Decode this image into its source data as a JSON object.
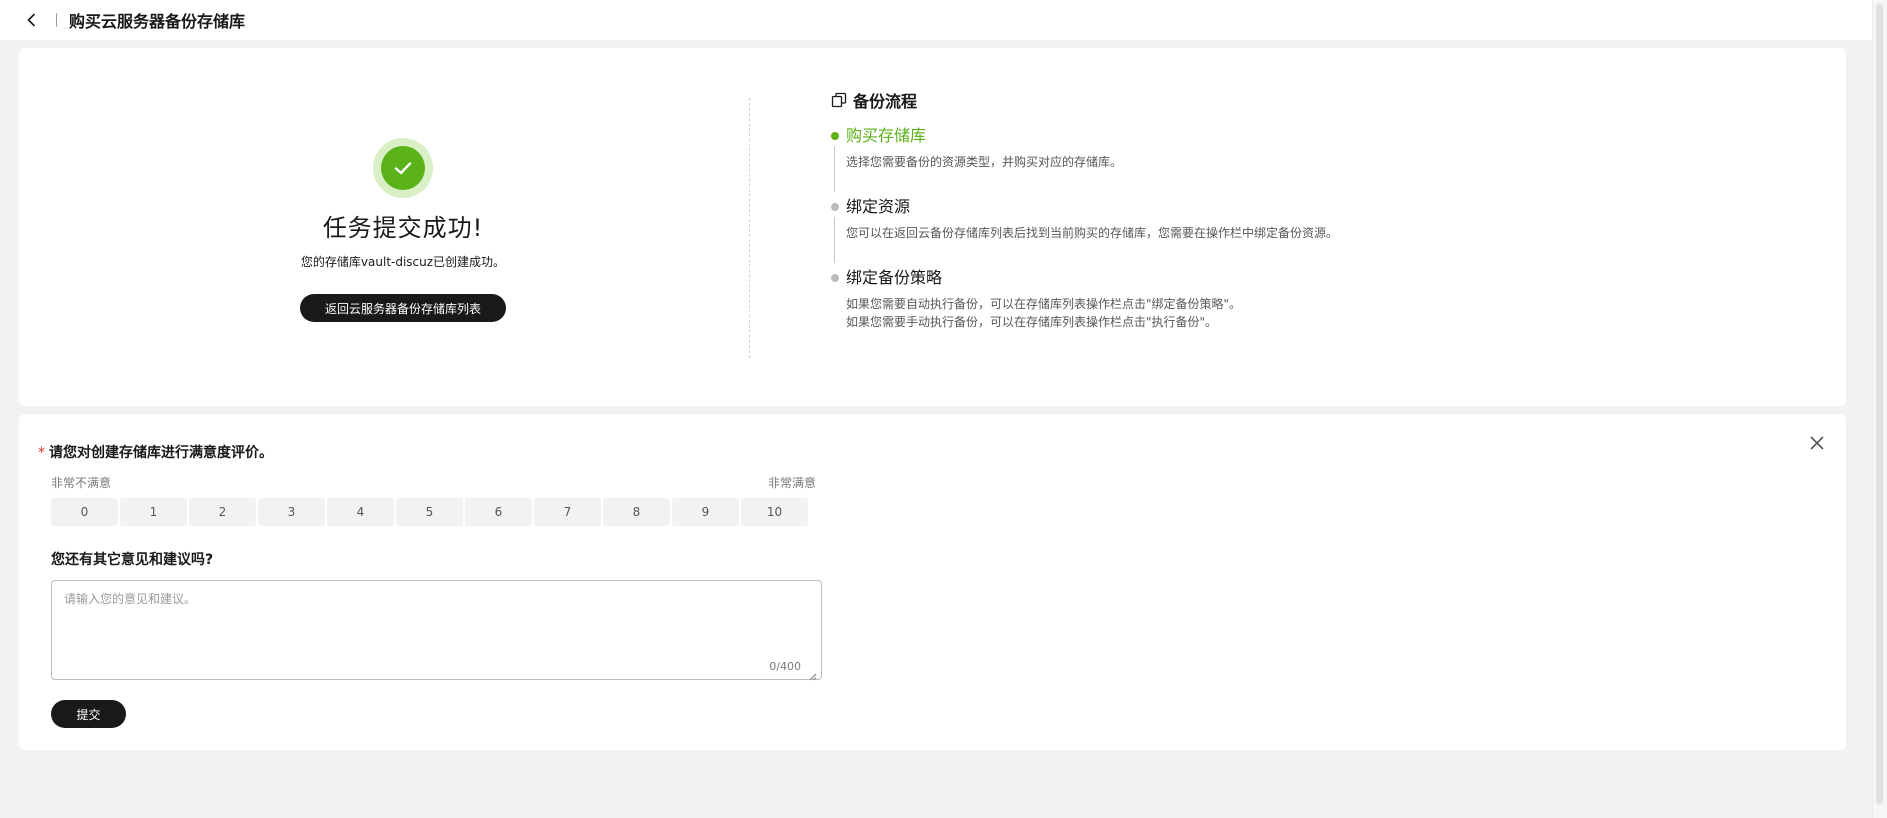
{
  "header": {
    "title": "购买云服务器备份存储库"
  },
  "success": {
    "title": "任务提交成功!",
    "description": "您的存储库vault-discuz已创建成功。",
    "return_button": "返回云服务器备份存储库列表"
  },
  "process": {
    "title": "备份流程",
    "steps": [
      {
        "title": "购买存储库",
        "desc1": "选择您需要备份的资源类型，并购买对应的存储库。",
        "desc2": ""
      },
      {
        "title": "绑定资源",
        "desc1": "您可以在返回云备份存储库列表后找到当前购买的存储库，您需要在操作栏中绑定备份资源。",
        "desc2": ""
      },
      {
        "title": "绑定备份策略",
        "desc1": "如果您需要自动执行备份，可以在存储库列表操作栏点击\"绑定备份策略\"。",
        "desc2": "如果您需要手动执行备份，可以在存储库列表操作栏点击\"执行备份\"。"
      }
    ]
  },
  "survey": {
    "required_mark": "*",
    "question1": "请您对创建存储库进行满意度评价。",
    "scale_low_label": "非常不满意",
    "scale_high_label": "非常满意",
    "scale": [
      "0",
      "1",
      "2",
      "3",
      "4",
      "5",
      "6",
      "7",
      "8",
      "9",
      "10"
    ],
    "question2": "您还有其它意见和建议吗?",
    "feedback_placeholder": "请输入您的意见和建议。",
    "feedback_value": "",
    "char_count": "0/400",
    "submit_button": "提交"
  },
  "colors": {
    "success_green": "#5cb319",
    "dark_button": "#191919",
    "required_red": "#e5322d"
  },
  "icons": {
    "back": "chevron-left-icon",
    "success": "check-circle-icon",
    "process": "copy-icon",
    "close": "close-icon"
  }
}
